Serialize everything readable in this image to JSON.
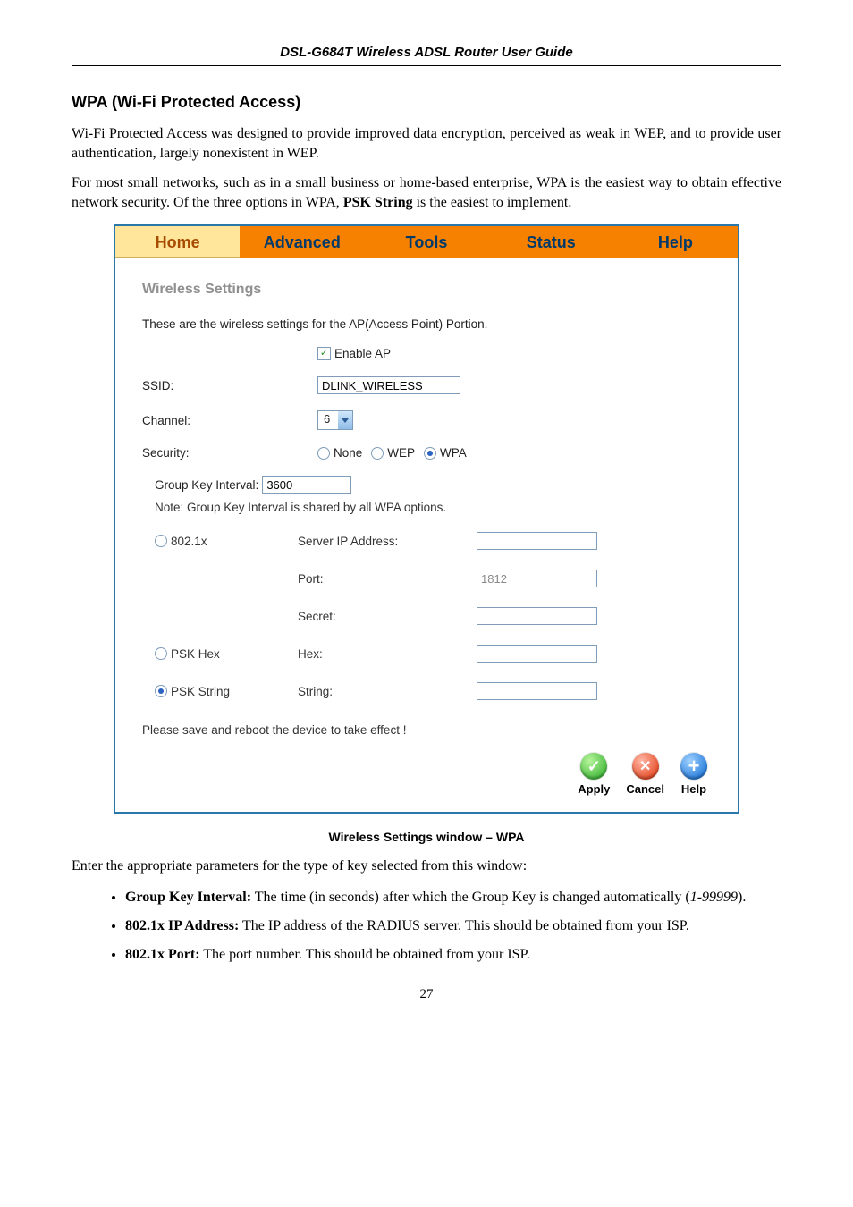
{
  "doc_header": "DSL-G684T Wireless ADSL Router User Guide",
  "section_title": "WPA (Wi-Fi Protected Access)",
  "para1": "Wi-Fi Protected Access was designed to provide improved data encryption, perceived as weak in WEP, and to provide user authentication, largely nonexistent in WEP.",
  "para2_a": "For most small networks, such as in a small business or home-based enterprise, WPA is the easiest way to obtain effective network security. Of the three options in WPA, ",
  "para2_b": "PSK String",
  "para2_c": " is the easiest to implement.",
  "tabs": {
    "home": "Home",
    "advanced": "Advanced",
    "tools": "Tools",
    "status": "Status",
    "help": "Help"
  },
  "panel": {
    "title": "Wireless Settings",
    "desc": "These are the wireless settings for the AP(Access Point) Portion.",
    "enable_ap": "Enable AP",
    "ssid_label": "SSID:",
    "ssid_value": "DLINK_WIRELESS",
    "channel_label": "Channel:",
    "channel_value": "6",
    "security_label": "Security:",
    "security_none": "None",
    "security_wep": "WEP",
    "security_wpa": "WPA",
    "gki_label": "Group Key Interval:",
    "gki_value": "3600",
    "gki_note": "Note: Group Key Interval is shared by all WPA options.",
    "opt_8021x": "802.1x",
    "server_ip_label": "Server IP Address:",
    "port_label": "Port:",
    "port_value": "1812",
    "secret_label": "Secret:",
    "opt_pskhex": "PSK Hex",
    "hex_label": "Hex:",
    "opt_pskstring": "PSK String",
    "string_label": "String:",
    "save_note": "Please save and reboot the device to take effect !",
    "apply": "Apply",
    "cancel": "Cancel",
    "help": "Help"
  },
  "figure_caption": "Wireless Settings window – WPA",
  "post_text": "Enter the appropriate parameters for the type of key selected from this window:",
  "bullets": {
    "b1_a": "Group Key Interval:",
    "b1_b": " The time (in seconds) after which the Group Key is changed automatically (",
    "b1_c": "1-99999",
    "b1_d": ").",
    "b2_a": "802.1x IP Address:",
    "b2_b": " The IP address of the RADIUS server. This should be obtained from your ISP.",
    "b3_a": "802.1x Port:",
    "b3_b": " The port number. This should be obtained from your ISP."
  },
  "page_number": "27"
}
